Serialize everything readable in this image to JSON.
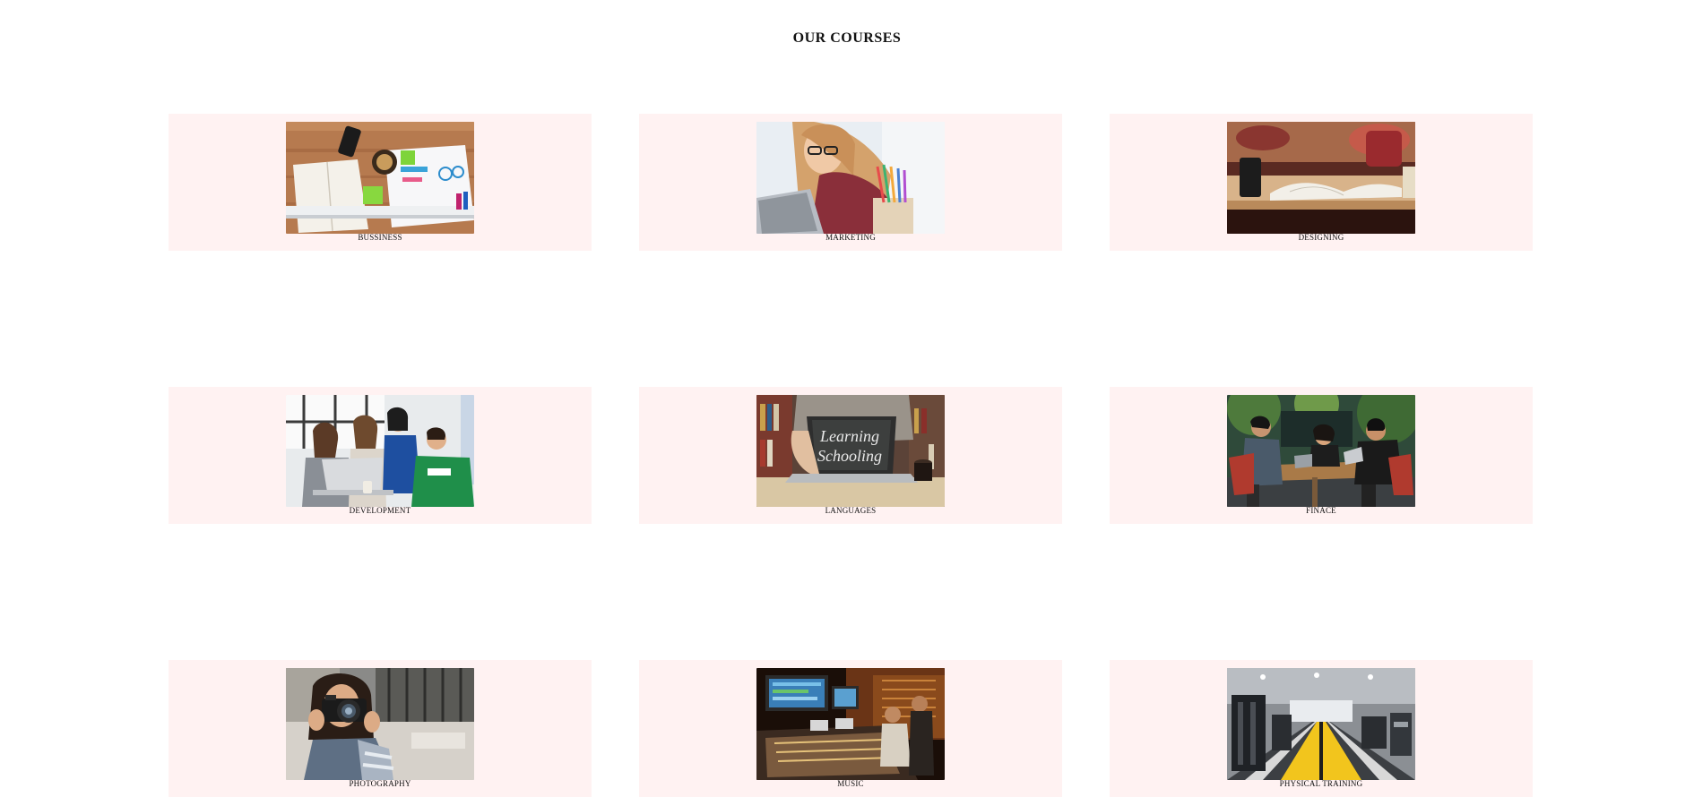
{
  "page": {
    "title": "OUR COURSES"
  },
  "courses": [
    {
      "label": "BUSSINESS",
      "image_subject": "desk-with-notebook-coffee-phone-charts"
    },
    {
      "label": "MARKETING",
      "image_subject": "woman-with-glasses-laptop-pencils"
    },
    {
      "label": "DESIGNING",
      "image_subject": "open-book-and-cup-on-table"
    },
    {
      "label": "DEVELOPMENT",
      "image_subject": "group-of-people-around-laptop"
    },
    {
      "label": "LANGUAGES",
      "image_subject": "laptop-with-learning-schooling-chalk-text"
    },
    {
      "label": "FINACE",
      "image_subject": "people-meeting-at-outdoor-table"
    },
    {
      "label": "PHOTOGRAPHY",
      "image_subject": "woman-holding-camera"
    },
    {
      "label": "MUSIC",
      "image_subject": "recording-studio-mixing-desk"
    },
    {
      "label": "PHYSICAL TRAINING",
      "image_subject": "gym-with-yellow-floor-lane"
    }
  ],
  "image_texts": {
    "languages_screen_line1": "Learning",
    "languages_screen_line2": "Schooling"
  },
  "colors": {
    "card_background": "#fff2f2",
    "page_background": "#ffffff",
    "text": "#111111"
  }
}
